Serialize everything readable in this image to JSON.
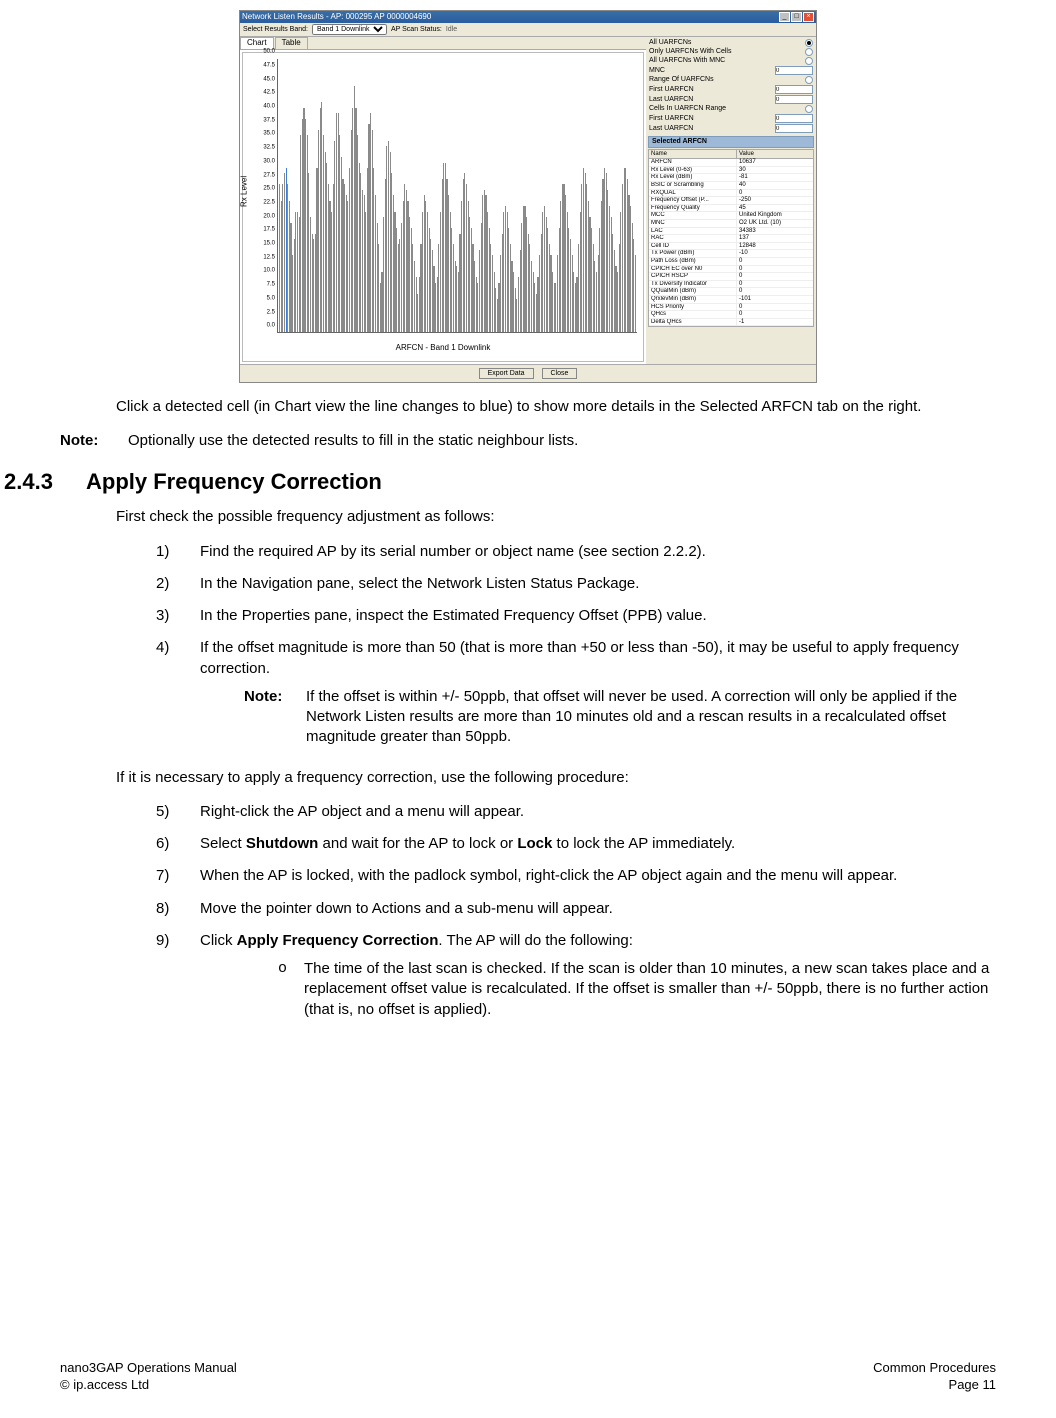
{
  "screenshot": {
    "title": "Network Listen Results - AP: 000295 AP 0000004690",
    "toolbar": {
      "select_label": "Select Results Band:",
      "select_value": "Band 1 Downlink",
      "status_label": "AP Scan Status:",
      "status_value": "Idle"
    },
    "tabs": {
      "chart": "Chart",
      "table": "Table"
    },
    "chart": {
      "ylabel": "Rx Level",
      "xlabel": "ARFCN - Band 1 Downlink"
    },
    "filters": {
      "all": "All UARFCNs",
      "withcells": "Only UARFCNs With Cells",
      "withmnc": "All UARFCNs With MNC",
      "mnc": "MNC",
      "range": "Range Of UARFCNs",
      "first": "First UARFCN",
      "last": "Last UARFCN",
      "cellsrange": "Cells In UARFCN Range",
      "first2": "First UARFCN",
      "last2": "Last UARFCN"
    },
    "selected_panel": "Selected ARFCN",
    "prop_head": {
      "name": "Name",
      "value": "Value"
    },
    "props": [
      {
        "n": "ARFCN",
        "v": "10637"
      },
      {
        "n": "Rx Level (0-63)",
        "v": "30"
      },
      {
        "n": "Rx Level (dBm)",
        "v": "-81"
      },
      {
        "n": "BSIC or Scrambling",
        "v": "40"
      },
      {
        "n": "RXQUAL",
        "v": "0"
      },
      {
        "n": "Frequency Offset (P...",
        "v": "-250"
      },
      {
        "n": "Frequency Quality",
        "v": "45"
      },
      {
        "n": "MCC",
        "v": "United Kingdom"
      },
      {
        "n": "MNC",
        "v": "O2 UK Ltd. (10)"
      },
      {
        "n": "LAC",
        "v": "34383"
      },
      {
        "n": "RAC",
        "v": "137"
      },
      {
        "n": "Cell ID",
        "v": "12848"
      },
      {
        "n": "Tx Power (dBm)",
        "v": "-10"
      },
      {
        "n": "Path Loss (dBm)",
        "v": "0"
      },
      {
        "n": "CPICH EC over N0",
        "v": "0"
      },
      {
        "n": "CPICH RSCP",
        "v": "0"
      },
      {
        "n": "Tx Diversity Indicator",
        "v": "0"
      },
      {
        "n": "QQualMin (dBm)",
        "v": "0"
      },
      {
        "n": "QrxlevMin (dBm)",
        "v": "-101"
      },
      {
        "n": "HCS Priority",
        "v": "0"
      },
      {
        "n": "QHcs",
        "v": "0"
      },
      {
        "n": "Delta QHcs",
        "v": "-1"
      }
    ],
    "buttons": {
      "export": "Export Data",
      "close": "Close"
    }
  },
  "chart_data": {
    "type": "bar",
    "ylabel": "Rx Level",
    "xlabel": "ARFCN - Band 1 Downlink",
    "ylim": [
      0,
      50
    ],
    "yticks": [
      0.0,
      2.5,
      5.0,
      7.5,
      10.0,
      12.5,
      15.0,
      17.5,
      20.0,
      22.5,
      25.0,
      27.5,
      30.0,
      32.5,
      35.0,
      37.5,
      40.0,
      42.5,
      45.0,
      47.5,
      50.0
    ],
    "selected_index": 4,
    "values": [
      27,
      24,
      27,
      29,
      30,
      27,
      24,
      20,
      14,
      17,
      22,
      22,
      21,
      36,
      39,
      41,
      39,
      36,
      29,
      21,
      18,
      17,
      18,
      30,
      37,
      41,
      42,
      36,
      33,
      31,
      27,
      24,
      22,
      27,
      35,
      40,
      40,
      36,
      32,
      28,
      27,
      25,
      24,
      30,
      37,
      41,
      45,
      41,
      36,
      31,
      29,
      26,
      25,
      22,
      30,
      38,
      40,
      37,
      30,
      25,
      20,
      16,
      9,
      11,
      21,
      28,
      34,
      35,
      33,
      29,
      25,
      22,
      19,
      16,
      17,
      20,
      24,
      27,
      26,
      24,
      21,
      19,
      16,
      13,
      10,
      7,
      10,
      16,
      22,
      25,
      24,
      22,
      19,
      17,
      15,
      12,
      9,
      10,
      16,
      22,
      28,
      31,
      31,
      28,
      25,
      22,
      19,
      16,
      13,
      12,
      11,
      18,
      24,
      28,
      29,
      27,
      24,
      21,
      19,
      16,
      13,
      10,
      9,
      15,
      20,
      25,
      26,
      25,
      22,
      19,
      16,
      14,
      11,
      8,
      6,
      9,
      14,
      18,
      22,
      23,
      22,
      19,
      16,
      13,
      11,
      8,
      6,
      10,
      15,
      20,
      23,
      23,
      21,
      18,
      16,
      13,
      11,
      9,
      7,
      10,
      14,
      18,
      22,
      23,
      21,
      19,
      16,
      14,
      11,
      9,
      9,
      14,
      19,
      24,
      27,
      27,
      25,
      22,
      19,
      17,
      14,
      11,
      9,
      10,
      16,
      22,
      27,
      30,
      29,
      27,
      24,
      21,
      19,
      16,
      13,
      11,
      14,
      19,
      24,
      28,
      30,
      29,
      26,
      23,
      21,
      18,
      15,
      12,
      11,
      16,
      22,
      27,
      30,
      30,
      28,
      25,
      23,
      20,
      17,
      14
    ]
  },
  "body": {
    "p1a": "Click a detected cell (in Chart view the line changes to blue) to show more details in the Selected ARFCN tab on the right.",
    "note1_label": "Note:",
    "note1_text": "Optionally use the detected results to fill in the static neighbour lists.",
    "h_num": "2.4.3",
    "h_text": "Apply Frequency Correction",
    "p2": "First check the possible frequency adjustment as follows:",
    "s1": "Find the required AP by its serial number or object name (see section 2.2.2).",
    "s2": "In the Navigation pane, select the Network Listen Status Package.",
    "s3": "In the Properties pane, inspect the Estimated Frequency Offset (PPB) value.",
    "s4": "If the offset magnitude is more than 50 (that is more than +50 or less than -50), it may be useful to apply frequency correction.",
    "s4note_label": "Note:",
    "s4note_text": "If the offset is within +/- 50ppb, that offset will never be used. A correction will only be applied if the Network Listen results are more than 10 minutes old and a rescan results in a recalculated offset magnitude greater than 50ppb.",
    "p3": "If it is necessary to apply a frequency correction, use the following procedure:",
    "s5": "Right-click the AP object and a menu will appear.",
    "s6a": "Select ",
    "s6b": "Shutdown",
    "s6c": " and wait for the AP to lock or ",
    "s6d": "Lock",
    "s6e": " to lock the AP immediately.",
    "s7": "When the AP is locked, with the padlock symbol, right-click the AP object again and the menu will appear.",
    "s8": "Move the pointer down to Actions and a sub-menu will appear.",
    "s9a": "Click ",
    "s9b": "Apply Frequency Correction",
    "s9c": ". The AP will do the following:",
    "b1": "The time of the last scan is checked. If the scan is older than 10 minutes, a new scan takes place and a replacement offset value is recalculated. If the offset is smaller than +/- 50ppb, there is no further action (that is, no offset is applied).",
    "n1": "1)",
    "n2": "2)",
    "n3": "3)",
    "n4": "4)",
    "n5": "5)",
    "n6": "6)",
    "n7": "7)",
    "n8": "8)",
    "n9": "9)",
    "bm": "o"
  },
  "footer": {
    "l1": "nano3GAP Operations Manual",
    "r1": "Common Procedures",
    "l2": "© ip.access Ltd",
    "r2": "Page 11"
  }
}
